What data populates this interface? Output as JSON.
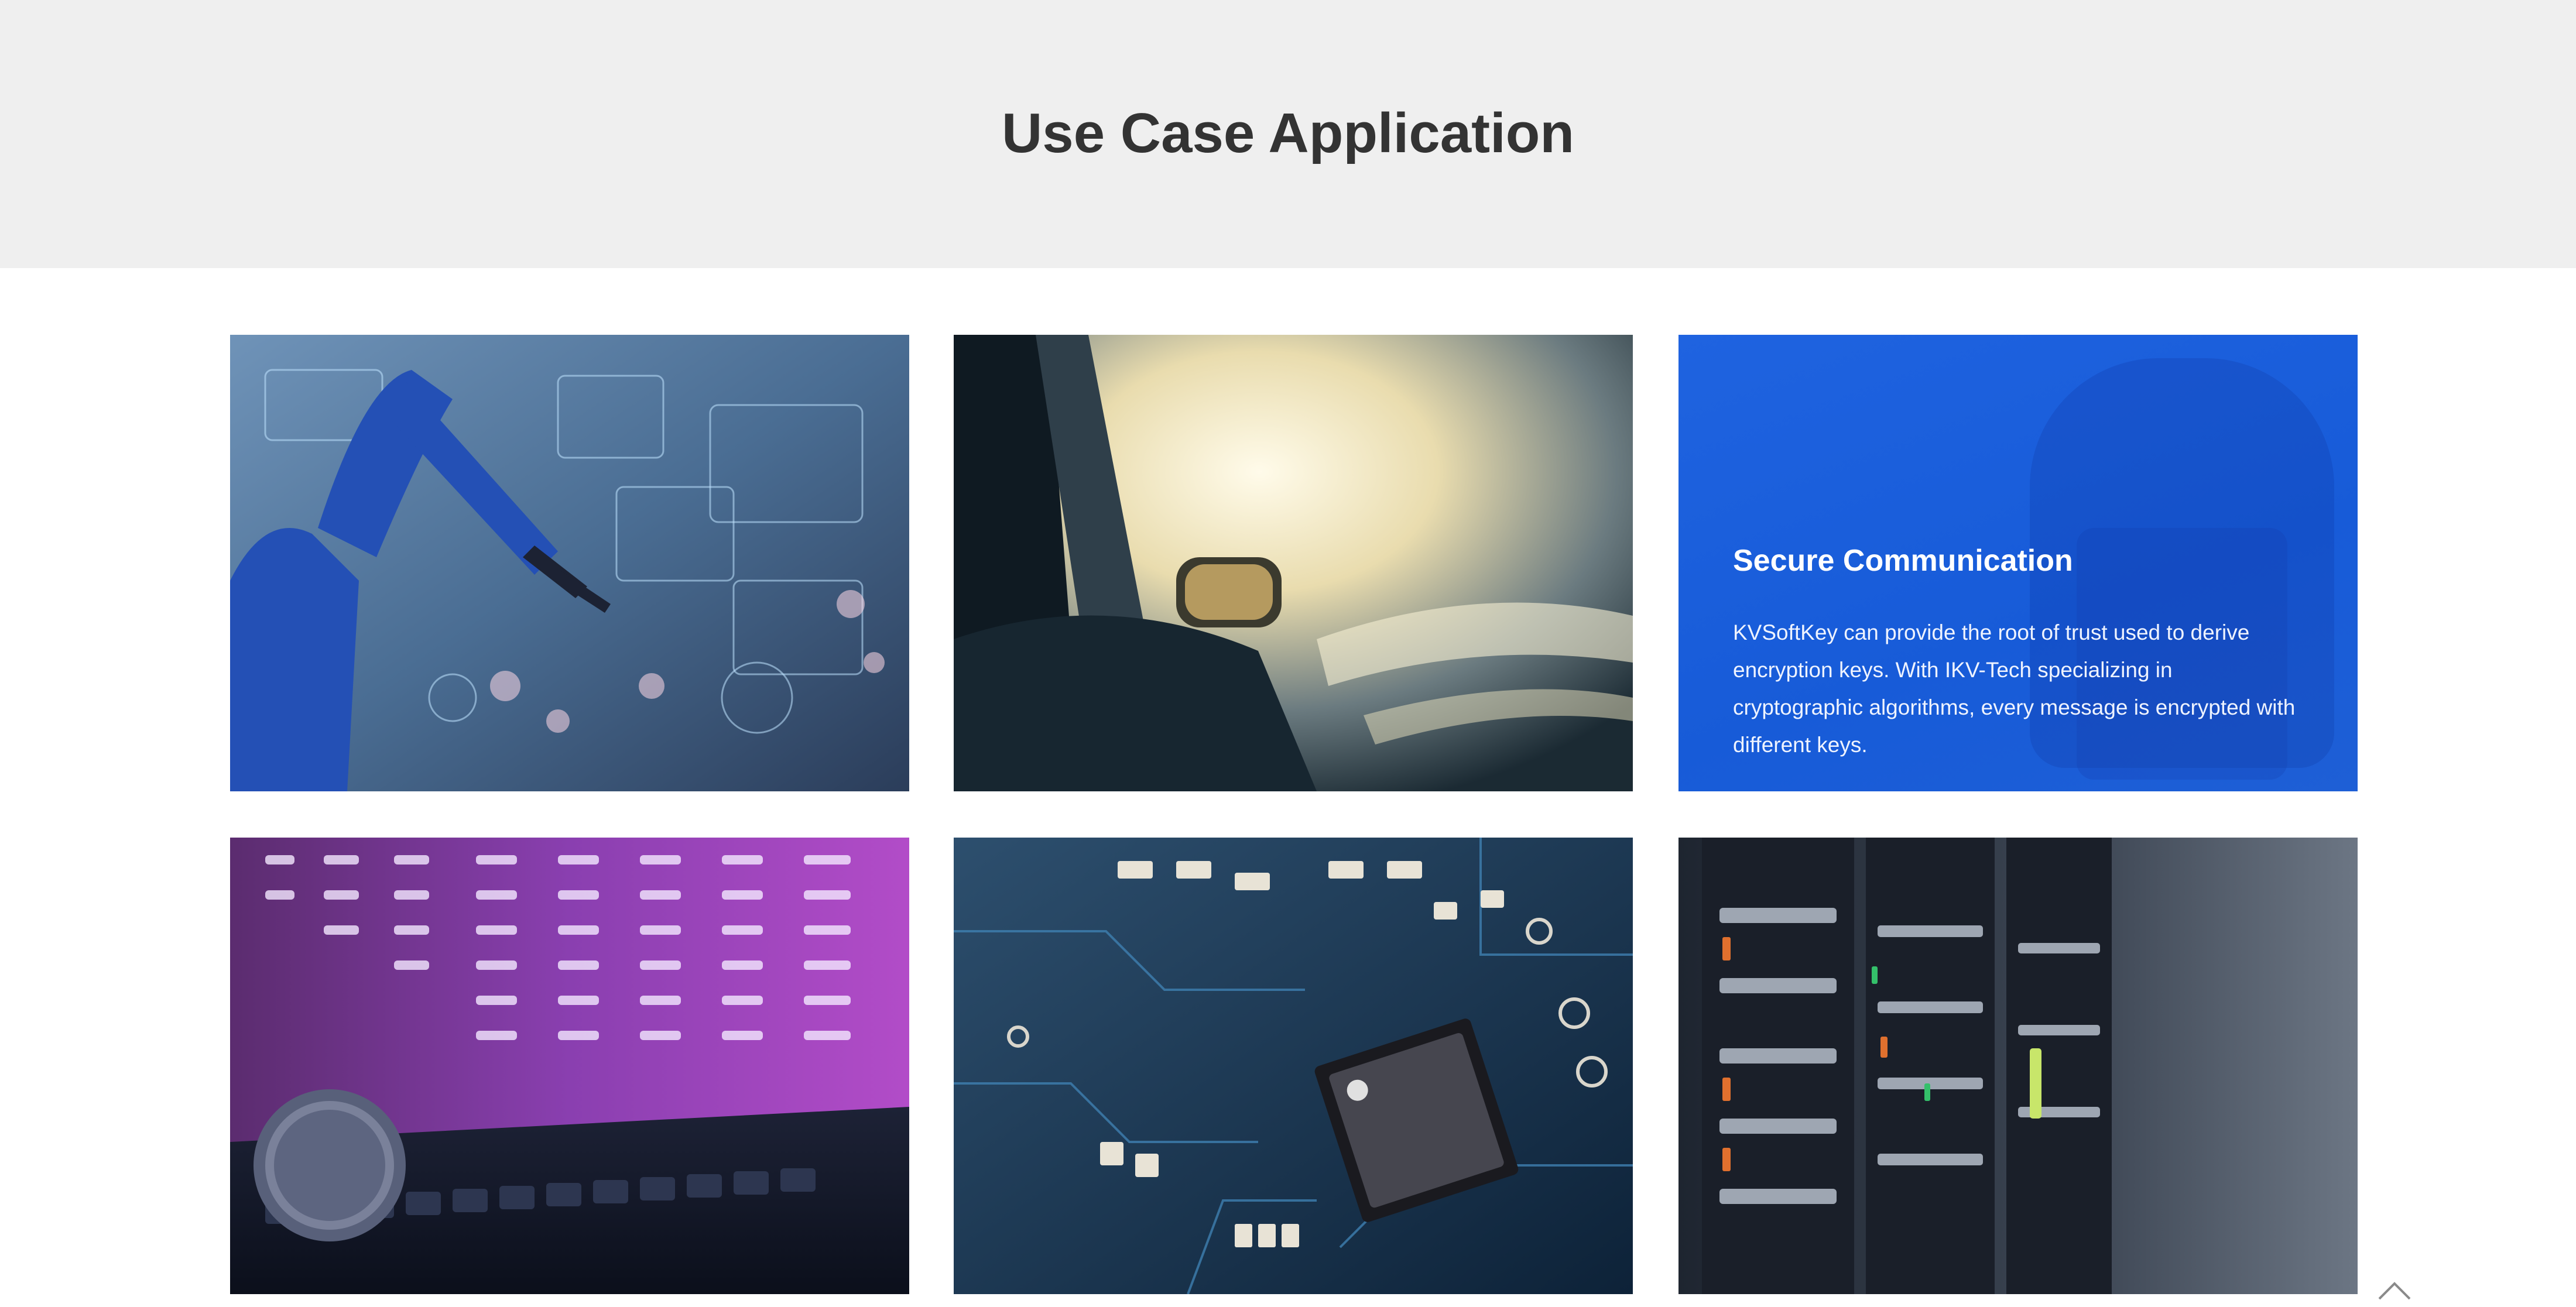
{
  "section": {
    "title": "Use Case Application"
  },
  "cards": [
    {
      "image": "robot-arm-technology-image"
    },
    {
      "image": "car-side-mirror-speed-image"
    },
    {
      "image": "hand-smartphone-image",
      "title": "Secure Communication",
      "description": "KVSoftKey can provide the root of trust used to derive encryption keys. With IKV-Tech specializing in cryptographic algorithms, every message is encrypted with different keys."
    },
    {
      "image": "bitcoin-keyboard-trading-image"
    },
    {
      "image": "circuit-board-chip-image"
    },
    {
      "image": "server-rack-image"
    }
  ],
  "colors": {
    "hero_bg": "#efefef",
    "title": "#333333",
    "accent_blue": "#1f63e0"
  },
  "icons": {
    "scroll_top": "chevron-up-icon"
  }
}
